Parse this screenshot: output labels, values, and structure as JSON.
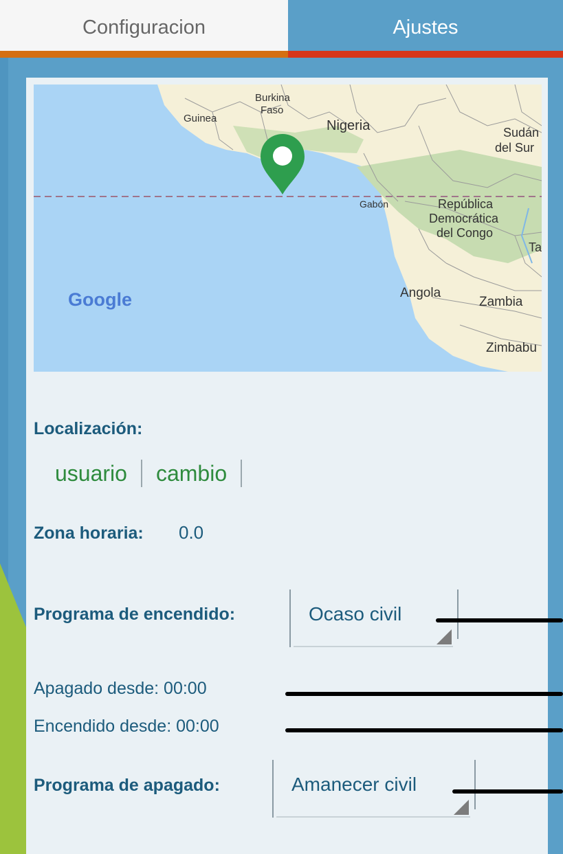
{
  "tabs": {
    "configuracion": "Configuracion",
    "ajustes": "Ajustes",
    "active": "Ajustes"
  },
  "map": {
    "labels": {
      "burkina": "Burkina",
      "faso": "Faso",
      "guinea": "Guinea",
      "nigeria": "Nigeria",
      "sudan1": "Sudán",
      "sudan2": "del Sur",
      "gabon": "Gabón",
      "rdc1": "República",
      "rdc2": "Democrática",
      "rdc3": "del Congo",
      "angola": "Angola",
      "zambia": "Zambia",
      "zimbabwe": "Zimbabu",
      "ta": "Ta",
      "google": "Google"
    },
    "marker_icon": "map-pin-icon",
    "colors": {
      "ocean": "#aad4f5",
      "land": "#f5f0d8",
      "forest": "#c7dcb1",
      "marker": "#2e9e4e",
      "equator": "#a0748a"
    }
  },
  "location": {
    "label": "Localización:",
    "links": [
      "usuario",
      "cambio"
    ]
  },
  "timezone": {
    "label": "Zona horaria:",
    "value": "0.0"
  },
  "on_schedule": {
    "label": "Programa de encendido:",
    "selected": "Ocaso civil"
  },
  "off_since": "Apagado desde: 00:00",
  "on_since": "Encendido desde: 00:00",
  "off_schedule": {
    "label": "Programa de apagado:",
    "selected": "Amanecer civil"
  },
  "colors": {
    "accent_blue": "#5a9fc8",
    "tab_orange": "#d46f12",
    "tab_red": "#d7361a",
    "link_green": "#2e8b3d",
    "text_blue": "#1c5b7c"
  }
}
